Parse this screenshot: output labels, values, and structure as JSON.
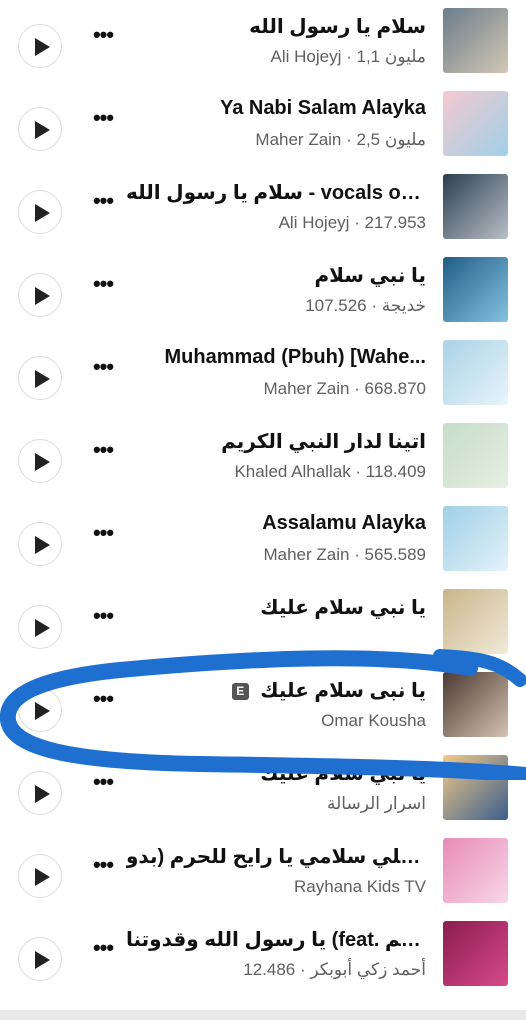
{
  "tracks": [
    {
      "title": "سلام يا رسول الله",
      "subtitle": "Ali Hojeyj · 1,1 مليون",
      "explicit": false,
      "thumb_colors": [
        "#6b7d8a",
        "#d2c7b4"
      ]
    },
    {
      "title": "Ya Nabi Salam Alayka",
      "subtitle": "Maher Zain · 2,5 مليون",
      "explicit": false,
      "thumb_colors": [
        "#f4c9cf",
        "#9fd0e8"
      ]
    },
    {
      "title": "سلام يا رسول الله - vocals only",
      "subtitle": "Ali Hojeyj · 217.953",
      "explicit": false,
      "thumb_colors": [
        "#2c3e50",
        "#b9bfc6"
      ]
    },
    {
      "title": "يا نبي سلام",
      "subtitle": "خديجة · 107.526",
      "explicit": false,
      "thumb_colors": [
        "#1f5f85",
        "#85c1e0"
      ]
    },
    {
      "title": "Muhammad (Pbuh) [Wahe...",
      "subtitle": "Maher Zain · 668.870",
      "explicit": false,
      "thumb_colors": [
        "#a9d3e6",
        "#e8f4fa"
      ]
    },
    {
      "title": "اتينا لدار النبي الكريم",
      "subtitle": "Khaled Alhallak · 118.409",
      "explicit": false,
      "thumb_colors": [
        "#c7dcc8",
        "#e6efe3"
      ]
    },
    {
      "title": "Assalamu Alayka",
      "subtitle": "Maher Zain · 565.589",
      "explicit": false,
      "thumb_colors": [
        "#9fd0e6",
        "#e3f2f9"
      ]
    },
    {
      "title": "يا نبي سلام عليك",
      "subtitle": "",
      "explicit": false,
      "thumb_colors": [
        "#c9b58a",
        "#f0ead8"
      ]
    },
    {
      "title": "يا نبى سلام عليك",
      "subtitle": "Omar Kousha",
      "explicit": true,
      "thumb_colors": [
        "#4a3a32",
        "#d6c2b2"
      ]
    },
    {
      "title": "يا نبي سلام عليك",
      "subtitle": "اسرار الرسالة",
      "explicit": false,
      "thumb_colors": [
        "#f1c98a",
        "#3b5e8c"
      ]
    },
    {
      "title": "وديلي سلامي يا رايح للحرم (بدو...",
      "subtitle": "Rayhana Kids TV",
      "explicit": false,
      "thumb_colors": [
        "#e88ab8",
        "#f7d7e6"
      ]
    },
    {
      "title": "يا رسول الله وقدوتنا (feat. محم...",
      "subtitle": "أحمد زكي أبوبكر · 12.486",
      "explicit": false,
      "thumb_colors": [
        "#8b1c4f",
        "#d64a8a"
      ]
    }
  ],
  "explicit_badge": "E",
  "more_label": "•••",
  "marker_color": "#1f6fd1"
}
